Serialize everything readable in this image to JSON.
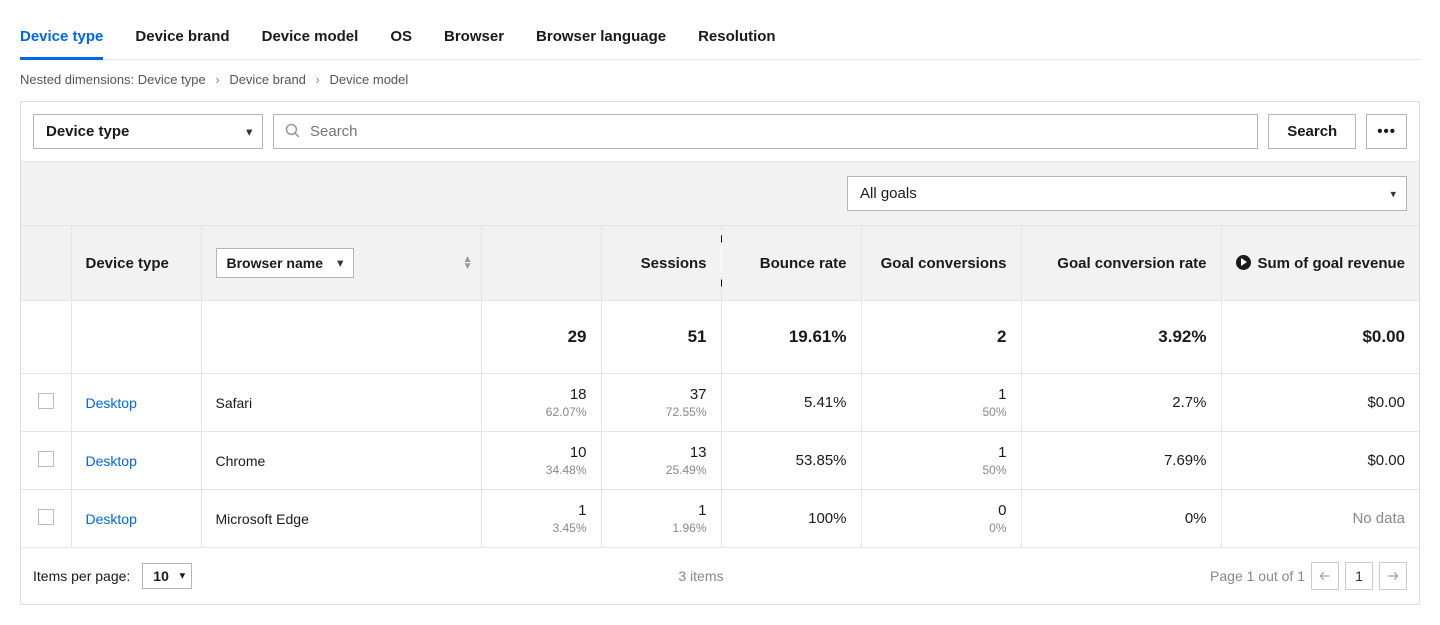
{
  "tabs": [
    {
      "label": "Device type",
      "active": true
    },
    {
      "label": "Device brand",
      "active": false
    },
    {
      "label": "Device model",
      "active": false
    },
    {
      "label": "OS",
      "active": false
    },
    {
      "label": "Browser",
      "active": false
    },
    {
      "label": "Browser language",
      "active": false
    },
    {
      "label": "Resolution",
      "active": false
    }
  ],
  "breadcrumb": {
    "prefix": "Nested dimensions:",
    "items": [
      "Device type",
      "Device brand",
      "Device model"
    ]
  },
  "controls": {
    "dimension_select": "Device type",
    "search_placeholder": "Search",
    "search_button": "Search",
    "more_button": "•••"
  },
  "goals_select": "All goals",
  "columns": {
    "device_type": "Device type",
    "browser_name_select": "Browser name",
    "sessions": "Sessions",
    "bounce": "Bounce rate",
    "goal_conv": "Goal conversions",
    "goal_rate": "Goal conversion rate",
    "goal_rev": "Sum of goal revenue"
  },
  "totals": {
    "users": "29",
    "sessions": "51",
    "bounce": "19.61%",
    "goal_conv": "2",
    "goal_rate": "3.92%",
    "goal_rev": "$0.00"
  },
  "rows": [
    {
      "device": "Desktop",
      "browser": "Safari",
      "users": "18",
      "users_pct": "62.07%",
      "sessions": "37",
      "sessions_pct": "72.55%",
      "bounce": "5.41%",
      "goal_conv": "1",
      "goal_conv_pct": "50%",
      "goal_rate": "2.7%",
      "goal_rev": "$0.00"
    },
    {
      "device": "Desktop",
      "browser": "Chrome",
      "users": "10",
      "users_pct": "34.48%",
      "sessions": "13",
      "sessions_pct": "25.49%",
      "bounce": "53.85%",
      "goal_conv": "1",
      "goal_conv_pct": "50%",
      "goal_rate": "7.69%",
      "goal_rev": "$0.00"
    },
    {
      "device": "Desktop",
      "browser": "Microsoft Edge",
      "users": "1",
      "users_pct": "3.45%",
      "sessions": "1",
      "sessions_pct": "1.96%",
      "bounce": "100%",
      "goal_conv": "0",
      "goal_conv_pct": "0%",
      "goal_rate": "0%",
      "goal_rev": "No data"
    }
  ],
  "footer": {
    "ipp_label": "Items per page:",
    "ipp_value": "10",
    "count": "3 items",
    "page_text": "Page 1 out of 1",
    "current_page": "1"
  }
}
